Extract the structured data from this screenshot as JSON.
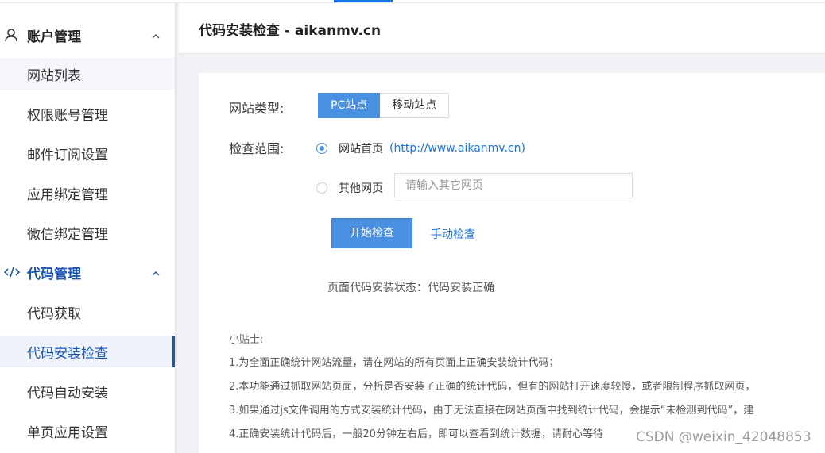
{
  "sidebar": {
    "groups": [
      {
        "label": "账户管理",
        "icon": "user-icon",
        "items": [
          "网站列表",
          "权限账号管理",
          "邮件订阅设置",
          "应用绑定管理",
          "微信绑定管理"
        ]
      },
      {
        "label": "代码管理",
        "icon": "code-icon",
        "items": [
          "代码获取",
          "代码安装检查",
          "代码自动安装",
          "单页应用设置"
        ]
      }
    ],
    "active_item": "代码安装检查",
    "accent_color": "#1a56b8"
  },
  "header": {
    "title": "代码安装检查 - aikanmv.cn"
  },
  "form": {
    "site_type_label": "网站类型:",
    "site_types": [
      "PC站点",
      "移动站点"
    ],
    "selected_site_type": "PC站点",
    "scope_label": "检查范围:",
    "scope_home_label": "网站首页",
    "scope_home_url": "(http://www.aikanmv.cn)",
    "scope_other_label": "其他网页",
    "other_page_placeholder": "请输入其它网页",
    "start_button": "开始检查",
    "manual_check_link": "手动检查",
    "primary_color": "#4a90e2"
  },
  "status": {
    "text": "页面代码安装状态：代码安装正确"
  },
  "tips": {
    "title": "小贴士:",
    "items": [
      "1.为全面正确统计网站流量，请在网站的所有页面上正确安装统计代码；",
      "2.本功能通过抓取网站页面，分析是否安装了正确的统计代码，但有的网站打开速度较慢，或者限制程序抓取网页，",
      "3.如果通过js文件调用的方式安装统计代码，由于无法直接在网站页面中找到统计代码，会提示“未检测到代码”，建",
      "4.正确安装统计代码后，一般20分钟左右后，即可以查看到统计数据，请耐心等待"
    ]
  },
  "watermark": "CSDN @weixin_42048853"
}
